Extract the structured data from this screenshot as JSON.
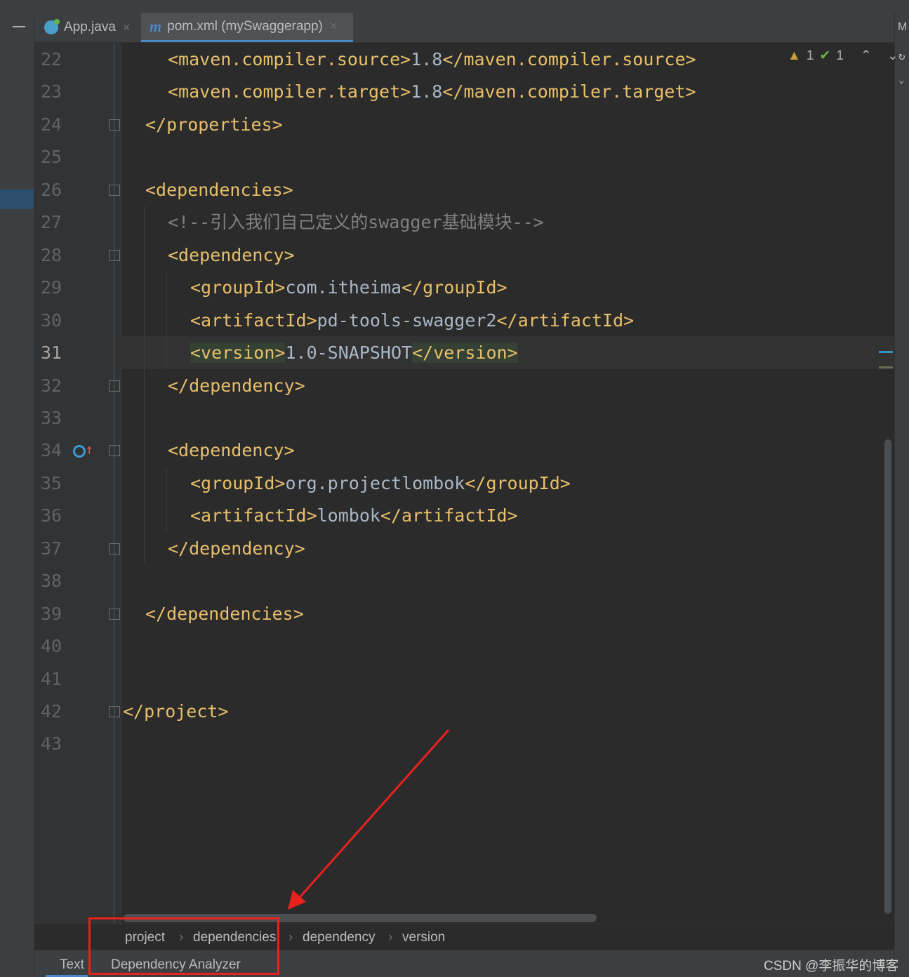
{
  "tabs": [
    {
      "label": "App.java",
      "active": false,
      "icon": "java-class-icon"
    },
    {
      "label": "pom.xml (mySwaggerapp)",
      "active": true,
      "icon": "maven-icon"
    }
  ],
  "inspections": {
    "warnings": "1",
    "weak_warnings": "1"
  },
  "editor": {
    "current_line": 31,
    "lines": [
      {
        "n": "22",
        "parts": [
          [
            "<maven.compiler.source>",
            "tag"
          ],
          [
            "1.8",
            "txt"
          ],
          [
            "</maven.compiler.source>",
            "tag"
          ]
        ]
      },
      {
        "n": "23",
        "parts": [
          [
            "<maven.compiler.target>",
            "tag"
          ],
          [
            "1.8",
            "txt"
          ],
          [
            "</maven.compiler.target>",
            "tag"
          ]
        ]
      },
      {
        "n": "24",
        "parts": [
          [
            "</properties>",
            "tag"
          ]
        ]
      },
      {
        "n": "25",
        "parts": []
      },
      {
        "n": "26",
        "parts": [
          [
            "<dependencies>",
            "tag"
          ]
        ]
      },
      {
        "n": "27",
        "parts": [
          [
            "<!--引入我们自己定义的swagger基础模块-->",
            "cmt"
          ]
        ]
      },
      {
        "n": "28",
        "parts": [
          [
            "<dependency>",
            "tag"
          ]
        ]
      },
      {
        "n": "29",
        "parts": [
          [
            "<groupId>",
            "tag"
          ],
          [
            "com.itheima",
            "txt"
          ],
          [
            "</groupId>",
            "tag"
          ]
        ]
      },
      {
        "n": "30",
        "parts": [
          [
            "<artifactId>",
            "tag"
          ],
          [
            "pd-tools-swagger2",
            "txt"
          ],
          [
            "</artifactId>",
            "tag"
          ]
        ]
      },
      {
        "n": "31",
        "parts": [
          [
            "<version>",
            "tag hl"
          ],
          [
            "1.0-SNAPSHOT",
            "txt"
          ],
          [
            "</version>",
            "tag hl"
          ]
        ]
      },
      {
        "n": "32",
        "parts": [
          [
            "</dependency>",
            "tag"
          ]
        ]
      },
      {
        "n": "33",
        "parts": []
      },
      {
        "n": "34",
        "parts": [
          [
            "<dependency>",
            "tag"
          ]
        ]
      },
      {
        "n": "35",
        "parts": [
          [
            "<groupId>",
            "tag"
          ],
          [
            "org.projectlombok",
            "txt"
          ],
          [
            "</groupId>",
            "tag"
          ]
        ]
      },
      {
        "n": "36",
        "parts": [
          [
            "<artifactId>",
            "tag"
          ],
          [
            "lombok",
            "txt"
          ],
          [
            "</artifactId>",
            "tag"
          ]
        ]
      },
      {
        "n": "37",
        "parts": [
          [
            "</dependency>",
            "tag"
          ]
        ]
      },
      {
        "n": "38",
        "parts": []
      },
      {
        "n": "39",
        "parts": [
          [
            "</dependencies>",
            "tag"
          ]
        ]
      },
      {
        "n": "40",
        "parts": []
      },
      {
        "n": "41",
        "parts": []
      },
      {
        "n": "42",
        "parts": [
          [
            "</project>",
            "tag"
          ]
        ]
      },
      {
        "n": "43",
        "parts": []
      }
    ]
  },
  "breadcrumb": [
    "project",
    "dependencies",
    "dependency",
    "version"
  ],
  "bottom_tabs": {
    "text": "Text",
    "dependency_analyzer": "Dependency Analyzer"
  },
  "watermark": "CSDN @李振华的博客",
  "colors": {
    "tag": "#e8bf6a",
    "text": "#a9b7c6",
    "comment": "#808080",
    "annotation": "#e8221d",
    "accent": "#4a88c7"
  }
}
